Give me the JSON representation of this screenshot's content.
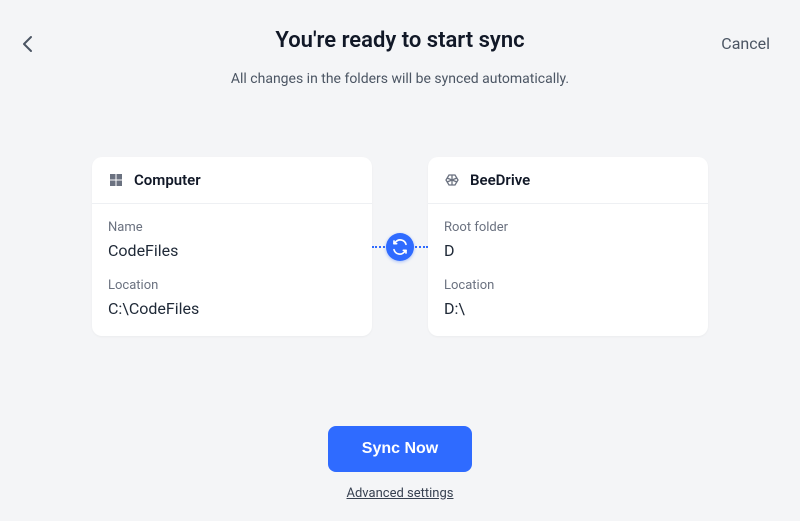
{
  "header": {
    "title": "You're ready to start sync",
    "subtitle": "All changes in the folders will be synced automatically.",
    "cancel_label": "Cancel"
  },
  "computer": {
    "title": "Computer",
    "name_label": "Name",
    "name_value": "CodeFiles",
    "location_label": "Location",
    "location_value": "C:\\CodeFiles"
  },
  "beedrive": {
    "title": "BeeDrive",
    "rootfolder_label": "Root folder",
    "rootfolder_value": "D",
    "location_label": "Location",
    "location_value": "D:\\"
  },
  "footer": {
    "primary_label": "Sync Now",
    "advanced_label": "Advanced settings"
  }
}
